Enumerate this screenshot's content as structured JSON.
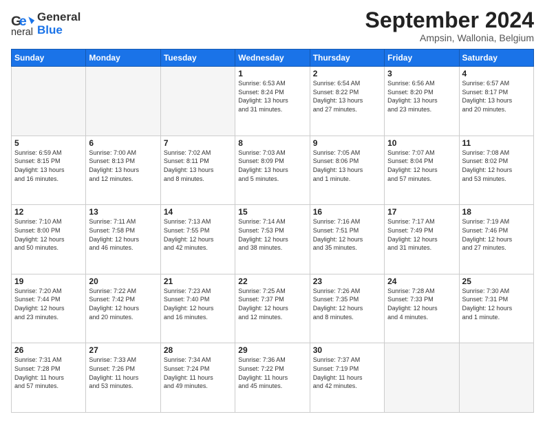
{
  "header": {
    "logo_line1": "General",
    "logo_line2": "Blue",
    "month_title": "September 2024",
    "location": "Ampsin, Wallonia, Belgium"
  },
  "weekdays": [
    "Sunday",
    "Monday",
    "Tuesday",
    "Wednesday",
    "Thursday",
    "Friday",
    "Saturday"
  ],
  "days": [
    {
      "num": "",
      "info": ""
    },
    {
      "num": "",
      "info": ""
    },
    {
      "num": "",
      "info": ""
    },
    {
      "num": "1",
      "info": "Sunrise: 6:53 AM\nSunset: 8:24 PM\nDaylight: 13 hours\nand 31 minutes."
    },
    {
      "num": "2",
      "info": "Sunrise: 6:54 AM\nSunset: 8:22 PM\nDaylight: 13 hours\nand 27 minutes."
    },
    {
      "num": "3",
      "info": "Sunrise: 6:56 AM\nSunset: 8:20 PM\nDaylight: 13 hours\nand 23 minutes."
    },
    {
      "num": "4",
      "info": "Sunrise: 6:57 AM\nSunset: 8:17 PM\nDaylight: 13 hours\nand 20 minutes."
    },
    {
      "num": "5",
      "info": "Sunrise: 6:59 AM\nSunset: 8:15 PM\nDaylight: 13 hours\nand 16 minutes."
    },
    {
      "num": "6",
      "info": "Sunrise: 7:00 AM\nSunset: 8:13 PM\nDaylight: 13 hours\nand 12 minutes."
    },
    {
      "num": "7",
      "info": "Sunrise: 7:02 AM\nSunset: 8:11 PM\nDaylight: 13 hours\nand 8 minutes."
    },
    {
      "num": "8",
      "info": "Sunrise: 7:03 AM\nSunset: 8:09 PM\nDaylight: 13 hours\nand 5 minutes."
    },
    {
      "num": "9",
      "info": "Sunrise: 7:05 AM\nSunset: 8:06 PM\nDaylight: 13 hours\nand 1 minute."
    },
    {
      "num": "10",
      "info": "Sunrise: 7:07 AM\nSunset: 8:04 PM\nDaylight: 12 hours\nand 57 minutes."
    },
    {
      "num": "11",
      "info": "Sunrise: 7:08 AM\nSunset: 8:02 PM\nDaylight: 12 hours\nand 53 minutes."
    },
    {
      "num": "12",
      "info": "Sunrise: 7:10 AM\nSunset: 8:00 PM\nDaylight: 12 hours\nand 50 minutes."
    },
    {
      "num": "13",
      "info": "Sunrise: 7:11 AM\nSunset: 7:58 PM\nDaylight: 12 hours\nand 46 minutes."
    },
    {
      "num": "14",
      "info": "Sunrise: 7:13 AM\nSunset: 7:55 PM\nDaylight: 12 hours\nand 42 minutes."
    },
    {
      "num": "15",
      "info": "Sunrise: 7:14 AM\nSunset: 7:53 PM\nDaylight: 12 hours\nand 38 minutes."
    },
    {
      "num": "16",
      "info": "Sunrise: 7:16 AM\nSunset: 7:51 PM\nDaylight: 12 hours\nand 35 minutes."
    },
    {
      "num": "17",
      "info": "Sunrise: 7:17 AM\nSunset: 7:49 PM\nDaylight: 12 hours\nand 31 minutes."
    },
    {
      "num": "18",
      "info": "Sunrise: 7:19 AM\nSunset: 7:46 PM\nDaylight: 12 hours\nand 27 minutes."
    },
    {
      "num": "19",
      "info": "Sunrise: 7:20 AM\nSunset: 7:44 PM\nDaylight: 12 hours\nand 23 minutes."
    },
    {
      "num": "20",
      "info": "Sunrise: 7:22 AM\nSunset: 7:42 PM\nDaylight: 12 hours\nand 20 minutes."
    },
    {
      "num": "21",
      "info": "Sunrise: 7:23 AM\nSunset: 7:40 PM\nDaylight: 12 hours\nand 16 minutes."
    },
    {
      "num": "22",
      "info": "Sunrise: 7:25 AM\nSunset: 7:37 PM\nDaylight: 12 hours\nand 12 minutes."
    },
    {
      "num": "23",
      "info": "Sunrise: 7:26 AM\nSunset: 7:35 PM\nDaylight: 12 hours\nand 8 minutes."
    },
    {
      "num": "24",
      "info": "Sunrise: 7:28 AM\nSunset: 7:33 PM\nDaylight: 12 hours\nand 4 minutes."
    },
    {
      "num": "25",
      "info": "Sunrise: 7:30 AM\nSunset: 7:31 PM\nDaylight: 12 hours\nand 1 minute."
    },
    {
      "num": "26",
      "info": "Sunrise: 7:31 AM\nSunset: 7:28 PM\nDaylight: 11 hours\nand 57 minutes."
    },
    {
      "num": "27",
      "info": "Sunrise: 7:33 AM\nSunset: 7:26 PM\nDaylight: 11 hours\nand 53 minutes."
    },
    {
      "num": "28",
      "info": "Sunrise: 7:34 AM\nSunset: 7:24 PM\nDaylight: 11 hours\nand 49 minutes."
    },
    {
      "num": "29",
      "info": "Sunrise: 7:36 AM\nSunset: 7:22 PM\nDaylight: 11 hours\nand 45 minutes."
    },
    {
      "num": "30",
      "info": "Sunrise: 7:37 AM\nSunset: 7:19 PM\nDaylight: 11 hours\nand 42 minutes."
    },
    {
      "num": "",
      "info": ""
    },
    {
      "num": "",
      "info": ""
    },
    {
      "num": "",
      "info": ""
    },
    {
      "num": "",
      "info": ""
    },
    {
      "num": "",
      "info": ""
    }
  ]
}
